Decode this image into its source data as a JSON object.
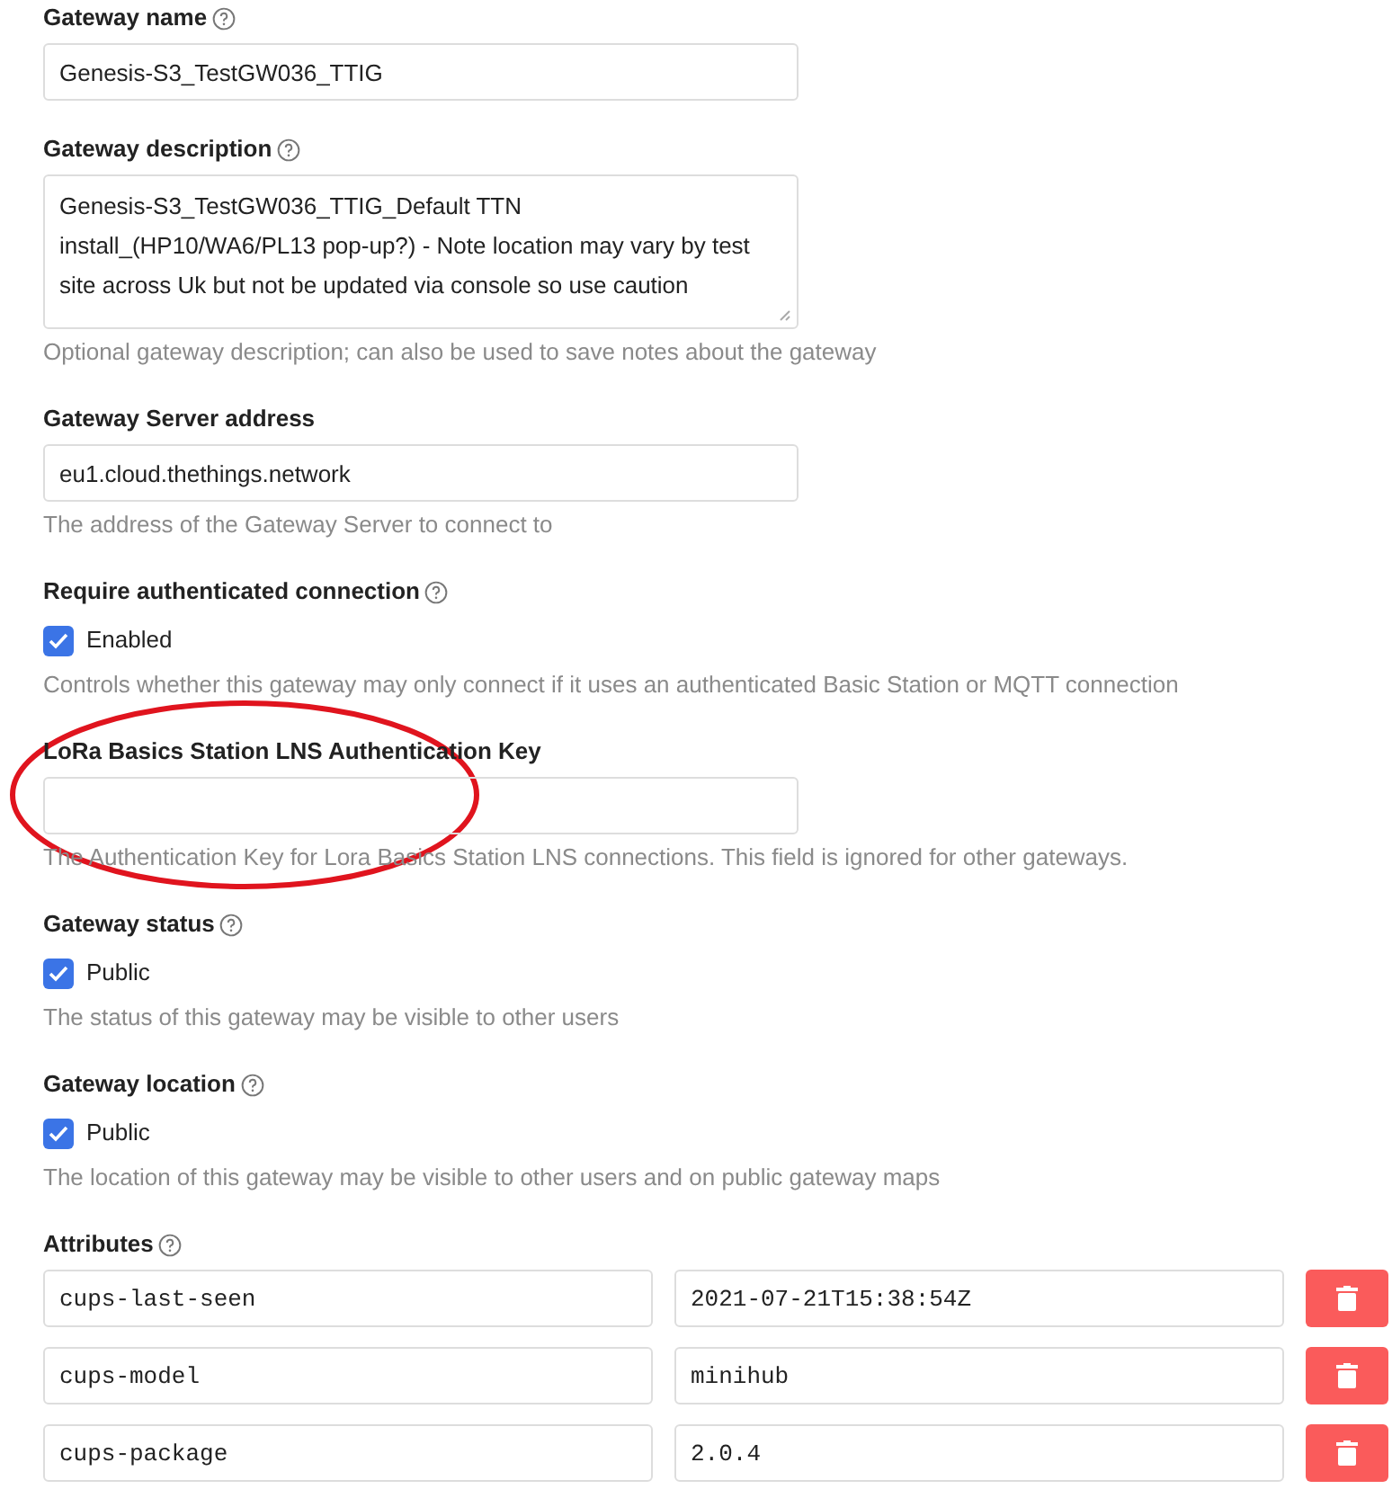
{
  "sections": [
    {
      "kind": "input",
      "label": "Gateway name",
      "help": true,
      "value": "Genesis-S3_TestGW036_TTIG"
    },
    {
      "kind": "textarea",
      "label": "Gateway description",
      "help": true,
      "value": "Genesis-S3_TestGW036_TTIG_Default TTN install_(HP10/WA6/PL13 pop-up?) - Note location may vary by test site across Uk but not be updated via console so use caution",
      "hint": "Optional gateway description; can also be used to save notes about the gateway"
    },
    {
      "kind": "input",
      "label": "Gateway Server address",
      "value": "eu1.cloud.thethings.network",
      "hint": "The address of the Gateway Server to connect to"
    },
    {
      "kind": "checkbox",
      "label": "Require authenticated connection",
      "help": true,
      "option": "Enabled",
      "checked": true,
      "hint": "Controls whether this gateway may only connect if it uses an authenticated Basic Station or MQTT connection"
    },
    {
      "kind": "input",
      "label": "LoRa Basics Station LNS Authentication Key",
      "hint": "The Authentication Key for Lora Basics Station LNS connections. This field is ignored for other gateways.",
      "circled": true
    },
    {
      "kind": "checkbox",
      "label": "Gateway status",
      "help": true,
      "option": "Public",
      "checked": true,
      "hint": "The status of this gateway may be visible to other users"
    },
    {
      "kind": "checkbox",
      "label": "Gateway location",
      "help": true,
      "option": "Public",
      "checked": true,
      "hint": "The location of this gateway may be visible to other users and on public gateway maps"
    }
  ],
  "attributes": {
    "label": "Attributes",
    "help": true,
    "rows": [
      {
        "key": "cups-last-seen",
        "value": "2021-07-21T15:38:54Z"
      },
      {
        "key": "cups-model",
        "value": "minihub"
      },
      {
        "key": "cups-package",
        "value": "2.0.4"
      }
    ]
  }
}
